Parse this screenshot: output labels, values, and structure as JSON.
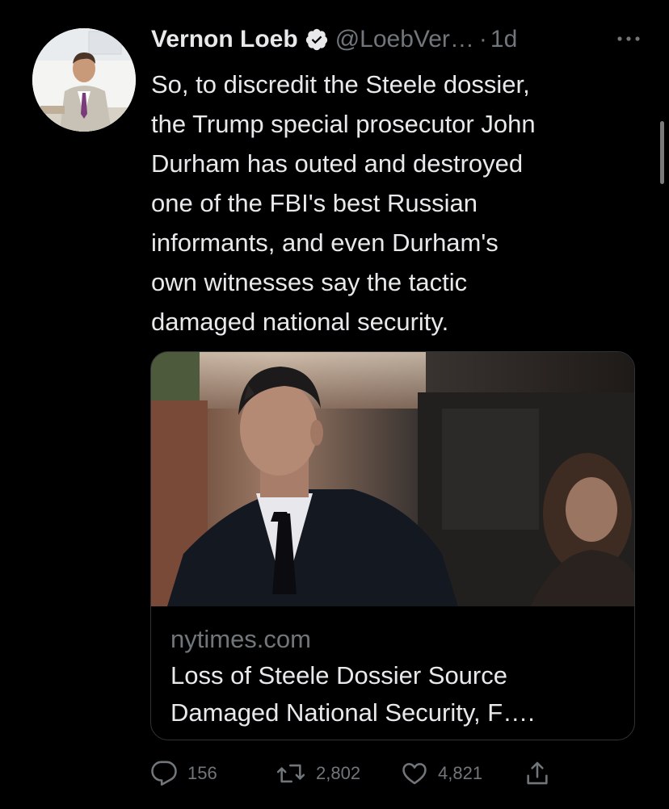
{
  "tweet": {
    "author_name": "Vernon Loeb",
    "handle": "@LoebVer…",
    "separator": "·",
    "time": "1d",
    "text_lines": [
      "So, to discredit the Steele dossier,",
      "the Trump special prosecutor John",
      "Durham has outed and destroyed",
      "one of the FBI's best Russian",
      "informants, and even Durham's",
      "own witnesses say the tactic",
      "damaged national security."
    ]
  },
  "card": {
    "domain": "nytimes.com",
    "title_lines": [
      "Loss of Steele Dossier Source",
      "Damaged National Security, F…."
    ]
  },
  "actions": {
    "reply_count": "156",
    "retweet_count": "2,802",
    "like_count": "4,821"
  },
  "icons": {
    "verified": "verified-badge-icon",
    "more": "more-dots-icon",
    "reply": "reply-icon",
    "retweet": "retweet-icon",
    "like": "heart-icon",
    "share": "share-icon"
  },
  "colors": {
    "background": "#000000",
    "text_primary": "#e7e9ea",
    "text_secondary": "#71767b",
    "card_border": "#2f3336"
  }
}
